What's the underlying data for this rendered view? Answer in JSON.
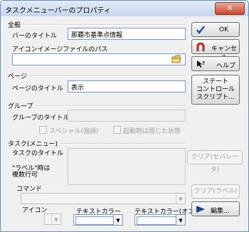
{
  "window": {
    "title": "タスクメニューバーのプロパティ",
    "close": "✕"
  },
  "general": {
    "group_label": "全般",
    "bar_title_label": "バーのタイトル",
    "bar_title_value": "那覇市基準点情報",
    "icon_path_label": "アイコンイメージファイルのパス",
    "icon_path_value": ""
  },
  "page": {
    "group_label": "ページ",
    "title_label": "ページのタイトル",
    "title_value": "表示"
  },
  "group": {
    "group_label": "グループ",
    "title_label": "グループのタイトル",
    "title_value": "",
    "special_label": "スペシャル(強調)",
    "collapsed_label": "起動時は閉じた状態"
  },
  "task": {
    "group_label": "タスク(メニュー)",
    "title_label": "タスクのタイトル",
    "multiline_label_1": "\"ラベル\"時は",
    "multiline_label_2": "複数行可",
    "command_label": "コマンド",
    "icon_label": "アイコン",
    "text_color_label": "テキストカラー",
    "text_color_on_label": "テキストカラー(オン)"
  },
  "buttons": {
    "ok": "OK",
    "cancel": "キャンセル",
    "help": "ヘルプ",
    "state_control_1": "ステート",
    "state_control_2": "コントロール",
    "state_control_3": "スクリプト...",
    "clear_separator": "クリア(セパレータ)",
    "clear_label": "クリア(ラベル)",
    "edit": "編集..."
  },
  "icons": {
    "ok": "check-icon",
    "cancel": "magnet-icon",
    "help": "help-arrow-icon",
    "browse": "folder-icon",
    "edit": "play-arrow-icon"
  },
  "colors": {
    "accent": "#1f4fa8",
    "ok_check": "#1f4fa8",
    "cancel_magnet": "#c81e1e",
    "edit_arrow": "#1f3f8f"
  }
}
